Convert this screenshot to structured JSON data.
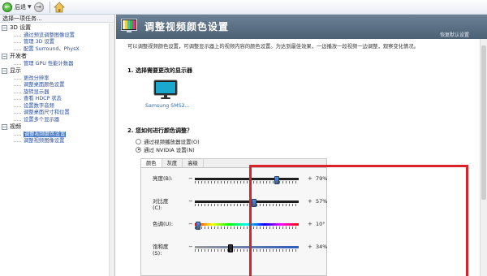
{
  "toolbar": {
    "back_label": "后退",
    "back_arrow": "←",
    "forward_arrow": "→",
    "dropdown_glyph": "▼",
    "icons": [
      "back-arrow-icon",
      "forward-arrow-icon",
      "home-icon"
    ]
  },
  "left_panel": {
    "title": "选择一项任务...",
    "categories": [
      {
        "toggle": "−",
        "label": "3D 设置",
        "items": [
          "通过预览调整图像设置",
          "管理 3D 设置",
          "配置 Surround、PhysX"
        ]
      },
      {
        "toggle": "−",
        "label": "开发者",
        "items": [
          "管理 GPU 性能计数器"
        ]
      },
      {
        "toggle": "−",
        "label": "显示",
        "items": [
          "更改分辨率",
          "调整桌面颜色设置",
          "旋转显示器",
          "查看 HDCP 状态",
          "设置数字音频",
          "调整桌面尺寸和位置",
          "设置多个显示器"
        ]
      },
      {
        "toggle": "−",
        "label": "视频",
        "items": [
          "调整视频颜色设置",
          "调整视频图像设置"
        ]
      }
    ],
    "selected_item": "调整视频颜色设置"
  },
  "right_panel": {
    "title": "调整视频颜色设置",
    "restore_link": "恢复默认设置",
    "intro": "可以调整视频颜色设置，可调整显示器上的视频内容的颜色设置。为达到最佳效果，一边播放一段视频一边调整，观察变化情况。",
    "section1_title": "1. 选择需要更改的显示器",
    "monitor_label": "Samsung SMS2...",
    "section2_title": "2. 您如何进行颜色调整？",
    "radio_options": [
      {
        "label": "通过视频播放器设置(O)",
        "checked": false
      },
      {
        "label": "通过 NVIDIA 设置(N)",
        "checked": true
      }
    ],
    "tabs": [
      "颜色",
      "灰度",
      "高级"
    ],
    "active_tab": "颜色",
    "sliders": [
      {
        "label_line1": "亮度(B):",
        "label_line2": "",
        "value_text": "79%",
        "level": 0.79,
        "style": "plain"
      },
      {
        "label_line1": "对比度",
        "label_line2": "(C):",
        "value_text": "57%",
        "level": 0.57,
        "style": "plain"
      },
      {
        "label_line1": "色调(U):",
        "label_line2": "",
        "value_text": "10°",
        "level": 0.03,
        "style": "hue"
      },
      {
        "label_line1": "饱和度",
        "label_line2": "(S):",
        "value_text": "34%",
        "level": 0.34,
        "style": "sat"
      }
    ],
    "minus_glyph": "−",
    "plus_glyph": "+",
    "highlight_color": "#d9222a",
    "header_color": "#5a6e83"
  }
}
